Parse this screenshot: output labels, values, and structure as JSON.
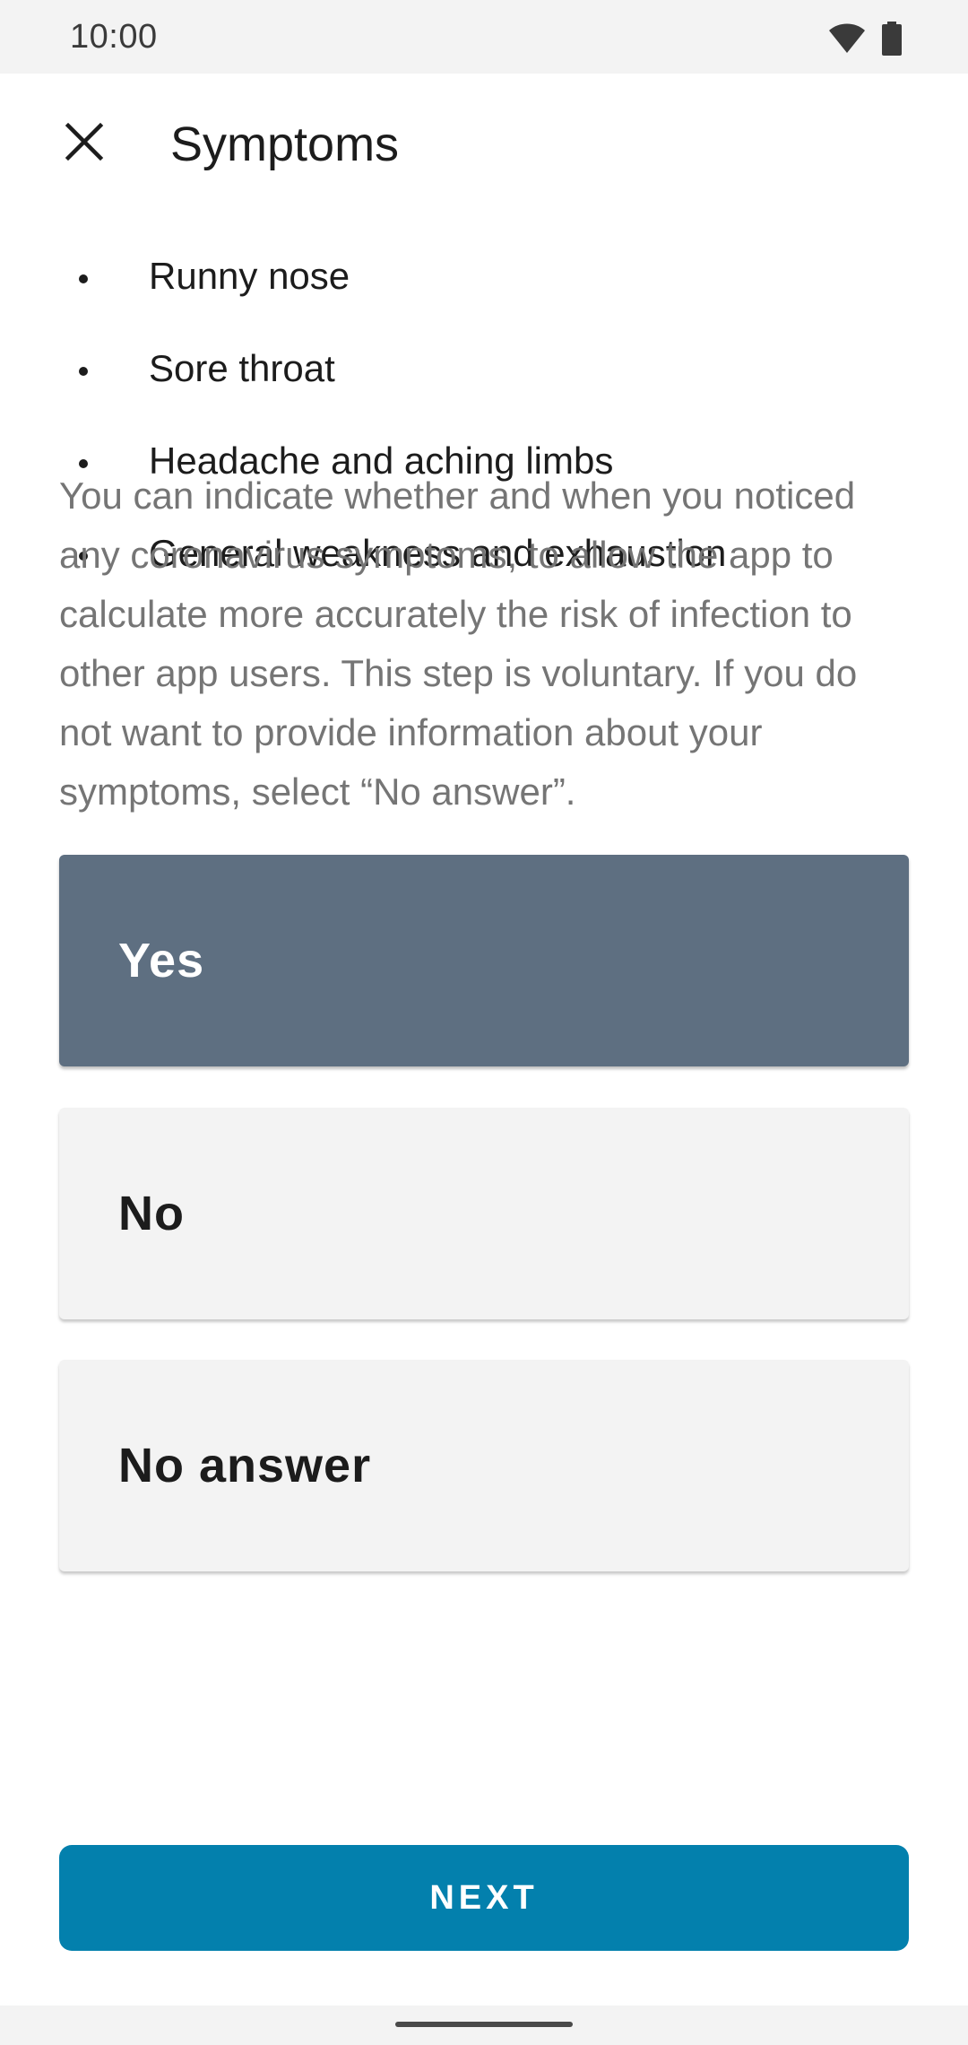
{
  "status_bar": {
    "time": "10:00",
    "icons": [
      "wifi-icon",
      "battery-icon"
    ]
  },
  "header": {
    "close_icon": "close-icon",
    "title": "Symptoms"
  },
  "symptoms": [
    "Runny nose",
    "Sore throat",
    "Headache and aching limbs",
    "General weakness and exhaustion"
  ],
  "description": "You can indicate whether and when you noticed any coronavirus symptoms, to allow the app to calculate more accurately the risk of infection to other app users. This step is voluntary. If you do not want to provide information about your symptoms, select “No answer”.",
  "options": [
    {
      "label": "Yes",
      "selected": true
    },
    {
      "label": "No",
      "selected": false
    },
    {
      "label": "No answer",
      "selected": false
    }
  ],
  "next_button": {
    "label": "NEXT"
  },
  "colors": {
    "selected_option": "#5e6f81",
    "unselected_option": "#f3f3f3",
    "primary_button": "#0380ad",
    "description_text": "#757575"
  }
}
